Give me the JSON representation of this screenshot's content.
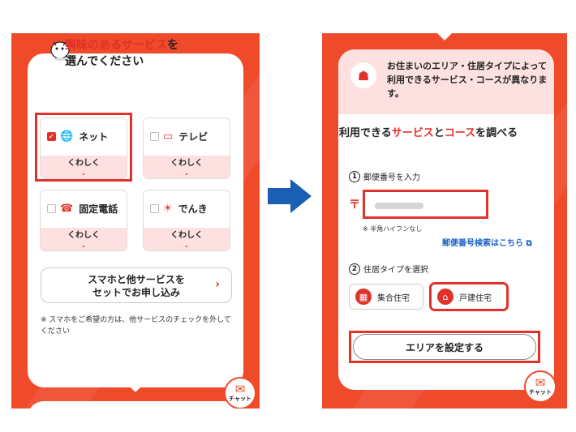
{
  "left": {
    "title_highlight": "興味のあるサービス",
    "title_rest": "を",
    "title_line2": "選んでください",
    "services": [
      {
        "name": "ネット",
        "detail": "くわしく",
        "checked": true,
        "icon": "globe-icon"
      },
      {
        "name": "テレビ",
        "detail": "くわしく",
        "checked": false,
        "icon": "tv-icon"
      },
      {
        "name": "固定電話",
        "detail": "くわしく",
        "checked": false,
        "icon": "phone-icon"
      },
      {
        "name": "でんき",
        "detail": "くわしく",
        "checked": false,
        "icon": "lightbulb-icon"
      }
    ],
    "set_button_line1": "スマホと他サービスを",
    "set_button_line2": "セットでお申し込み",
    "note": "※ スマホをご希望の方は、他サービスのチェックを外してください",
    "chat_label": "チャット"
  },
  "right": {
    "info_text": "お住まいのエリア・住居タイプによって利用できるサービス・コースが異なります。",
    "title_pre": "利用できる",
    "title_red1": "サービス",
    "title_mid": "と",
    "title_red2": "コース",
    "title_post": "を調べる",
    "step1_num": "1",
    "step1_label": "郵便番号を入力",
    "postal_mark": "〒",
    "zip_hint": "※ 半角ハイフンなし",
    "zip_search_link": "郵便番号検索はこちら",
    "step2_num": "2",
    "step2_label": "住居タイプを選択",
    "type_apartment": "集合住宅",
    "type_house": "戸建住宅",
    "area_button": "エリアを設定する",
    "chat_label": "チャット"
  },
  "colors": {
    "brand_red": "#ef4a2a",
    "accent_red": "#e0312a",
    "pink": "#fde1e1",
    "arrow_blue": "#1a5fb4",
    "link_blue": "#1d62c4"
  }
}
